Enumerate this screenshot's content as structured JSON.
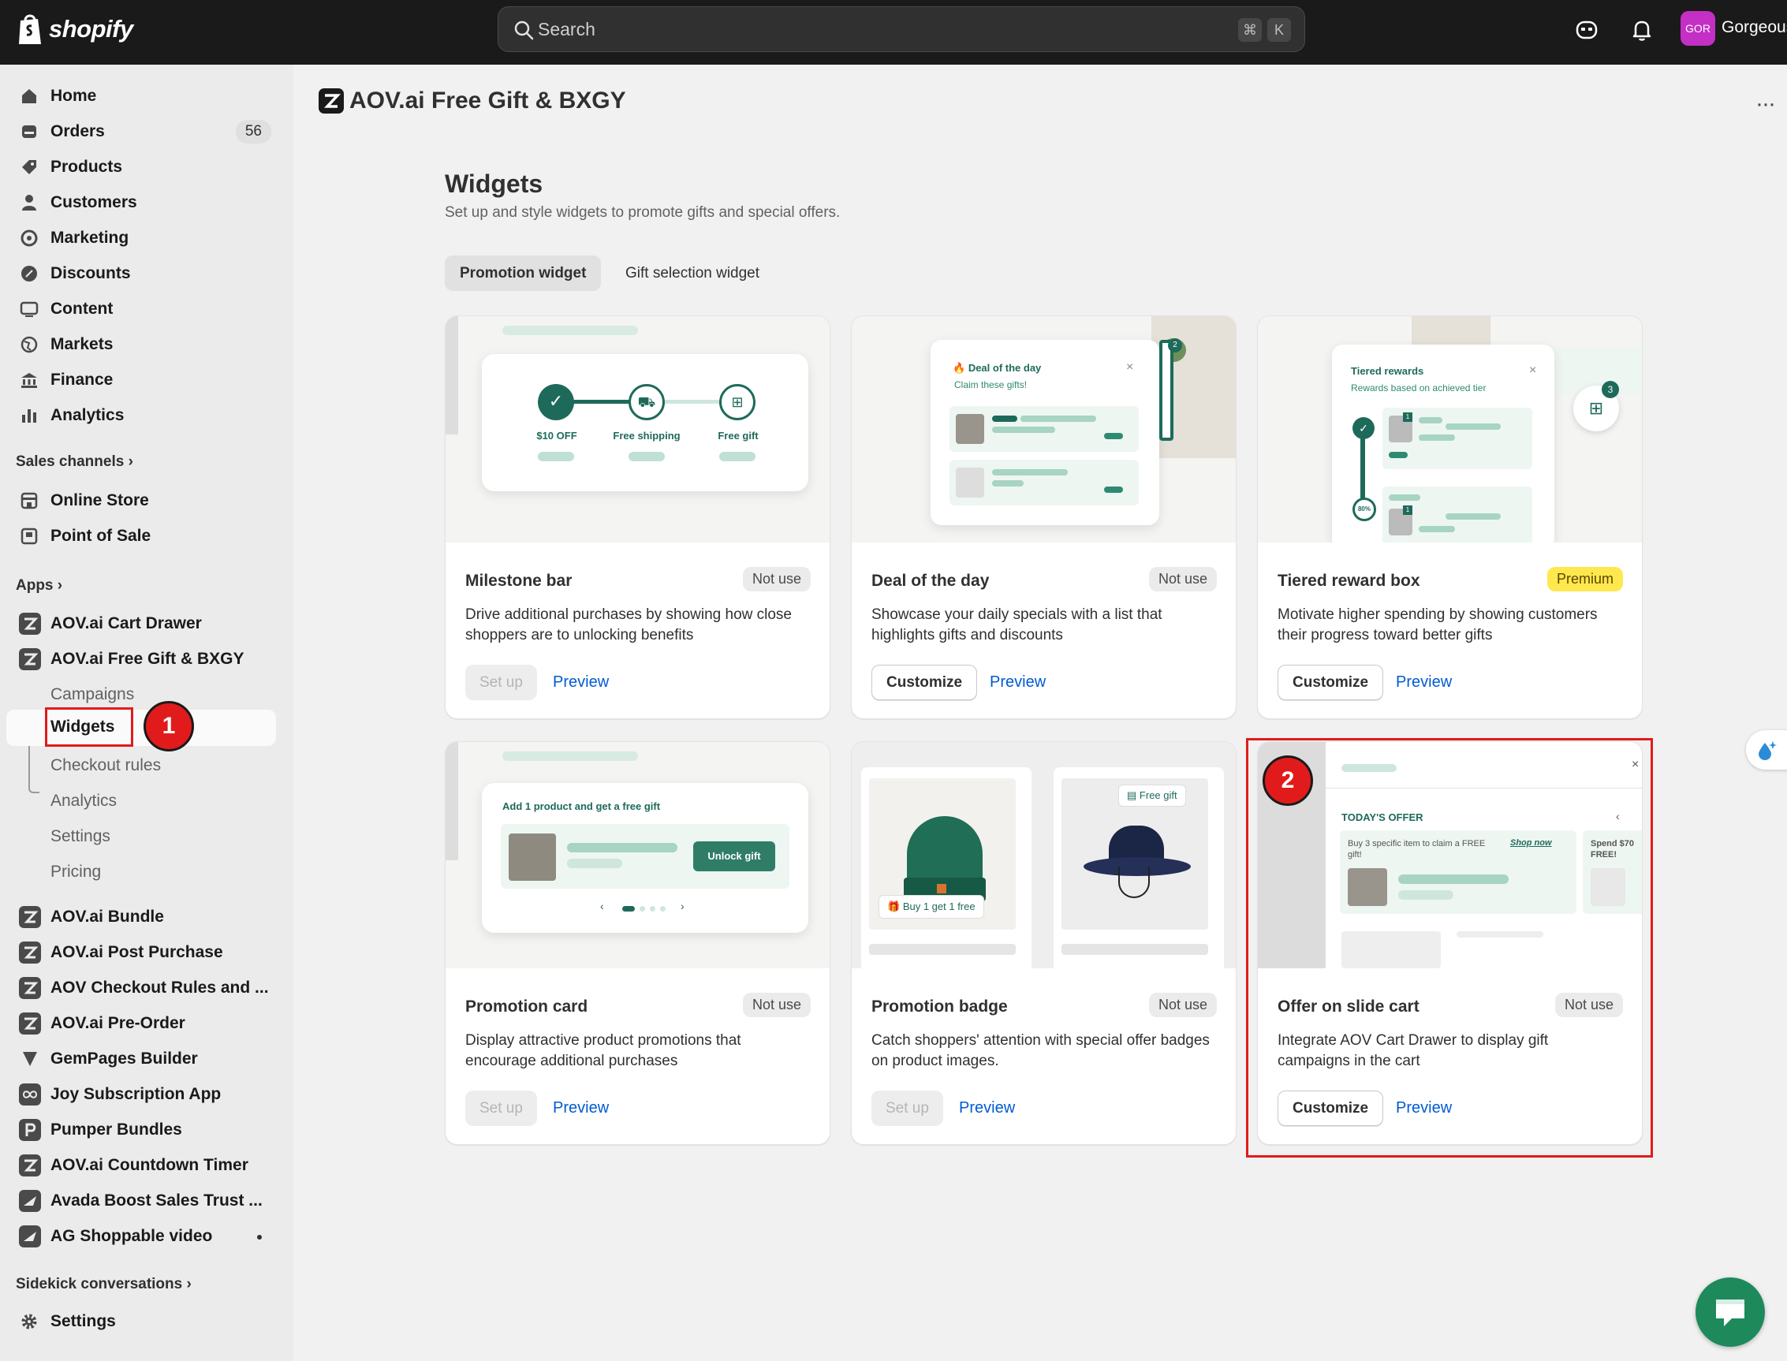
{
  "brand": {
    "name": "shopify"
  },
  "search": {
    "placeholder": "Search",
    "shortcut_keys": [
      "⌘",
      "K"
    ]
  },
  "store": {
    "initials": "GOR",
    "name": "Gorgeous"
  },
  "sidebar": {
    "main_items": [
      {
        "label": "Home",
        "icon": "home-icon"
      },
      {
        "label": "Orders",
        "icon": "orders-icon",
        "count": "56"
      },
      {
        "label": "Products",
        "icon": "tag-icon"
      },
      {
        "label": "Customers",
        "icon": "person-icon"
      },
      {
        "label": "Marketing",
        "icon": "target-icon"
      },
      {
        "label": "Discounts",
        "icon": "discount-icon"
      },
      {
        "label": "Content",
        "icon": "content-icon"
      },
      {
        "label": "Markets",
        "icon": "globe-icon"
      },
      {
        "label": "Finance",
        "icon": "bank-icon"
      },
      {
        "label": "Analytics",
        "icon": "bar-chart-icon"
      }
    ],
    "sales_channels_label": "Sales channels",
    "sales_channels": [
      {
        "label": "Online Store"
      },
      {
        "label": "Point of Sale"
      }
    ],
    "apps_label": "Apps",
    "apps_top": [
      {
        "label": "AOV.ai Cart Drawer"
      },
      {
        "label": "AOV.ai Free Gift & BXGY"
      }
    ],
    "sub_items": [
      {
        "label": "Campaigns"
      },
      {
        "label": "Widgets"
      },
      {
        "label": "Checkout rules"
      },
      {
        "label": "Analytics"
      },
      {
        "label": "Settings"
      },
      {
        "label": "Pricing"
      }
    ],
    "apps_more": [
      {
        "label": "AOV.ai Bundle"
      },
      {
        "label": "AOV.ai Post Purchase"
      },
      {
        "label": "AOV Checkout Rules and ..."
      },
      {
        "label": "AOV.ai Pre-Order"
      },
      {
        "label": "GemPages Builder"
      },
      {
        "label": "Joy Subscription App"
      },
      {
        "label": "Pumper Bundles"
      },
      {
        "label": "AOV.ai Countdown Timer"
      },
      {
        "label": "Avada Boost Sales Trust ..."
      },
      {
        "label": "AG Shoppable video"
      }
    ],
    "sidekick_label": "Sidekick conversations",
    "settings_label": "Settings"
  },
  "header": {
    "app_title": "AOV.ai Free Gift & BXGY",
    "more": "···"
  },
  "page": {
    "title": "Widgets",
    "subtitle": "Set up and style widgets to promote gifts and special offers.",
    "tabs": [
      {
        "label": "Promotion widget"
      },
      {
        "label": "Gift selection widget"
      }
    ]
  },
  "cards": [
    {
      "title": "Milestone bar",
      "status": "Not use",
      "desc": "Drive additional purchases by showing how close shoppers are to unlocking benefits",
      "primary": "Set up",
      "preview": "Preview",
      "illustration": {
        "steps": [
          "$10 OFF",
          "Free shipping",
          "Free gift"
        ]
      }
    },
    {
      "title": "Deal of the day",
      "status": "Not use",
      "desc": "Showcase your daily specials with a list that highlights gifts and discounts",
      "primary": "Customize",
      "preview": "Preview",
      "illustration": {
        "heading": "Deal of the day",
        "sub": "Claim these gifts!",
        "close": "×",
        "badge": "2"
      }
    },
    {
      "title": "Tiered reward box",
      "status": "Premium",
      "desc": "Motivate higher spending by showing customers their progress toward better gifts",
      "primary": "Customize",
      "preview": "Preview",
      "illustration": {
        "heading": "Tiered rewards",
        "sub": "Rewards based on achieved tier",
        "close": "×",
        "badge": "3",
        "tier": "80%",
        "tag": "1"
      }
    },
    {
      "title": "Promotion card",
      "status": "Not use",
      "desc": "Display attractive product promotions that encourage additional purchases",
      "primary": "Set up",
      "preview": "Preview",
      "illustration": {
        "heading": "Add 1 product and get a free gift",
        "button": "Unlock gift",
        "prev": "‹",
        "next": "›"
      }
    },
    {
      "title": "Promotion badge",
      "status": "Not use",
      "desc": "Catch shoppers' attention with special offer badges on product images.",
      "primary": "Set up",
      "preview": "Preview",
      "illustration": {
        "badge_a": "Buy 1 get 1 free",
        "badge_b": "Free gift"
      }
    },
    {
      "title": "Offer on slide cart",
      "status": "Not use",
      "desc": "Integrate AOV Cart Drawer to display gift campaigns in the cart",
      "primary": "Customize",
      "preview": "Preview",
      "illustration": {
        "heading": "TODAY'S OFFER",
        "text": "Buy 3 specific item to claim a FREE gift!",
        "link": "Shop now",
        "text2": "Spend $70 FREE!",
        "close": "×",
        "nav": "‹"
      }
    }
  ],
  "annotations": [
    {
      "number": "1"
    },
    {
      "number": "2"
    }
  ],
  "colors": {
    "topbar": "#1a1a1a",
    "accent_green": "#1e6a5a",
    "link_blue": "#005bd3",
    "annotation_red": "#e11b1b",
    "premium_yellow": "#ffe84e"
  }
}
